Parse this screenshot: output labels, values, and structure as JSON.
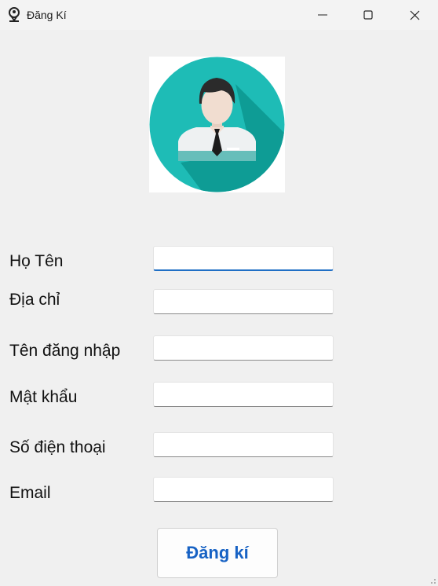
{
  "window": {
    "title": "Đăng Kí",
    "icon": "pin-user-icon",
    "controls": [
      "minimize-icon",
      "maximize-icon",
      "close-icon"
    ]
  },
  "avatar": {
    "icon": "user-avatar-icon",
    "colors": {
      "circle": "#1ebcb6",
      "shadow": "#0e9c95",
      "hair": "#2b2b2b",
      "skin": "#f1ddd0",
      "shirt": "#eef1f2",
      "tie": "#1c1c1c"
    }
  },
  "form": {
    "fields": [
      {
        "label": "Họ Tên",
        "value": ""
      },
      {
        "label": "Địa chỉ",
        "value": ""
      },
      {
        "label": "Tên đăng nhập",
        "value": ""
      },
      {
        "label": "Mật khẩu",
        "value": ""
      },
      {
        "label": "Số điện thoại",
        "value": ""
      },
      {
        "label": "Email",
        "value": ""
      }
    ],
    "submit_label": "Đăng kí"
  },
  "colors": {
    "accent": "#1762c4",
    "background": "#f0f0f0"
  }
}
